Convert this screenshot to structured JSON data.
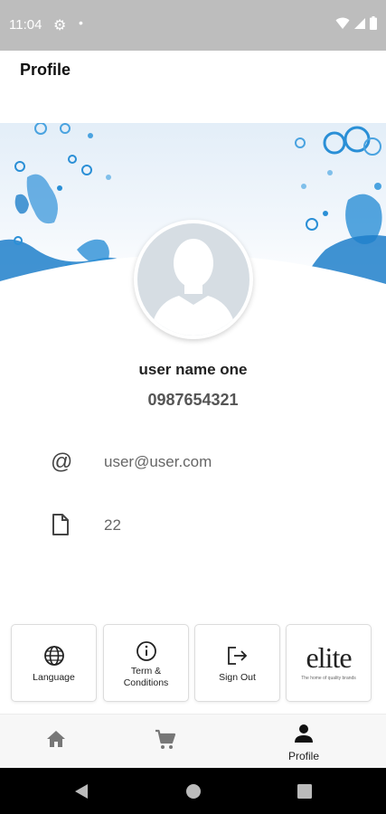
{
  "status_bar": {
    "time": "11:04"
  },
  "header": {
    "title": "Profile"
  },
  "profile": {
    "name": "user name one",
    "phone": "0987654321",
    "email": "user@user.com",
    "document_value": "22"
  },
  "actions": {
    "language": "Language",
    "terms_line1": "Term &",
    "terms_line2": "Conditions",
    "sign_out": "Sign Out",
    "brand_logo": "elite",
    "brand_tagline": "The home of quality brands"
  },
  "bottom_nav": {
    "profile_label": "Profile"
  },
  "colors": {
    "accent_blue": "#2a8fd6",
    "avatar_bg": "#d6dde3",
    "nav_bg": "#f7f7f7",
    "status_bar": "#bdbdbd"
  },
  "icons": [
    "gear-icon",
    "wifi-icon",
    "signal-icon",
    "battery-icon",
    "at-icon",
    "document-icon",
    "globe-icon",
    "info-icon",
    "sign-out-icon",
    "home-icon",
    "cart-icon",
    "person-icon",
    "back-icon",
    "home-circle-icon",
    "recents-icon"
  ]
}
